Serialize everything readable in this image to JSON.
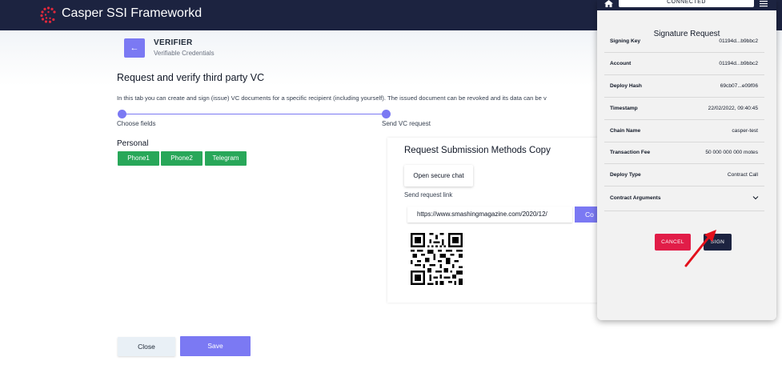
{
  "navbar": {
    "title": "Casper SSI Frameworkd"
  },
  "header": {
    "back_glyph": "←",
    "section_title": "VERIFIER",
    "section_subtitle": "Verifiable Credentials"
  },
  "main": {
    "heading": "Request and verify third party VC",
    "description": "In this tab you can create and sign (issue) VC documents for a specific recipient (including yourself). The issued document can be revoked and its data can be v",
    "steps": [
      {
        "label": "Choose fields"
      },
      {
        "label": "Send VC request"
      }
    ],
    "section_label": "Personal",
    "chips": [
      {
        "label": "Phone1"
      },
      {
        "label": "Phone2"
      },
      {
        "label": "Telegram"
      }
    ],
    "close_label": "Close",
    "save_label": "Save"
  },
  "card": {
    "title": "Request Submission Methods Copy",
    "open_chat_label": "Open secure chat",
    "link_label": "Send request link",
    "link_value": "https://www.smashingmagazine.com/2020/12/",
    "copy_label": "Co"
  },
  "wallet": {
    "status": "CONNECTED",
    "title": "Signature Request",
    "rows": [
      {
        "key": "Signing Key",
        "value": "01194d...b9bbc2"
      },
      {
        "key": "Account",
        "value": "01194d...b9bbc2"
      },
      {
        "key": "Deploy Hash",
        "value": "69cb07...e09f06"
      },
      {
        "key": "Timestamp",
        "value": "22/02/2022, 09:40:45"
      },
      {
        "key": "Chain Name",
        "value": "casper-test"
      },
      {
        "key": "Transaction Fee",
        "value": "50 000 000 000 motes"
      },
      {
        "key": "Deploy Type",
        "value": "Contract Call"
      }
    ],
    "contract_args_label": "Contract Arguments",
    "cancel_label": "CANCEL",
    "sign_label": "SIGN"
  },
  "colors": {
    "navbar": "#1c2340",
    "accent": "#7b79f3",
    "chip": "#28a759",
    "cancel": "#e11d48",
    "logo": "#e0283c",
    "arrow": "#e3101c"
  }
}
